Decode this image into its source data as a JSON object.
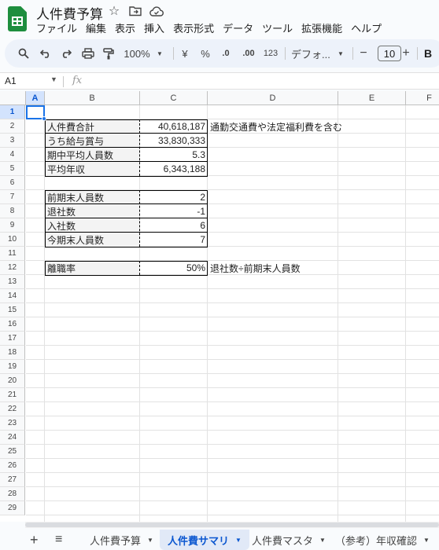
{
  "app": {
    "doc_title": "人件費予算",
    "menu": [
      "ファイル",
      "編集",
      "表示",
      "挿入",
      "表示形式",
      "データ",
      "ツール",
      "拡張機能",
      "ヘルプ"
    ]
  },
  "toolbar": {
    "zoom": "100%",
    "currency": "¥",
    "percent": "%",
    "dec_decrease": ".0",
    "dec_increase": ".00",
    "number_format": "123",
    "font": "デフォ...",
    "font_size": "10",
    "minus": "−",
    "plus": "+",
    "bold": "B"
  },
  "formula_bar": {
    "cell_ref": "A1",
    "fx": "fx",
    "value": ""
  },
  "columns": [
    "A",
    "B",
    "C",
    "D",
    "E",
    "F"
  ],
  "rows": [
    "1",
    "2",
    "3",
    "4",
    "5",
    "6",
    "7",
    "8",
    "9",
    "10",
    "11",
    "12",
    "13",
    "14",
    "15",
    "16",
    "17",
    "18",
    "19",
    "20",
    "21",
    "22",
    "23",
    "24",
    "25",
    "26",
    "27",
    "28",
    "29"
  ],
  "table1": [
    {
      "label": "人件費合計",
      "value": "40,618,187",
      "note": "通勤交通費や法定福利費を含む"
    },
    {
      "label": "うち給与賞与",
      "value": "33,830,333",
      "note": ""
    },
    {
      "label": "期中平均人員数",
      "value": "5.3",
      "note": ""
    },
    {
      "label": "平均年収",
      "value": "6,343,188",
      "note": ""
    }
  ],
  "table2": [
    {
      "label": "前期末人員数",
      "value": "2"
    },
    {
      "label": "退社数",
      "value": "-1"
    },
    {
      "label": "入社数",
      "value": "6"
    },
    {
      "label": "今期末人員数",
      "value": "7"
    }
  ],
  "table3": [
    {
      "label": "離職率",
      "value": "50%",
      "note": "退社数÷前期末人員数"
    }
  ],
  "sheet_tabs": {
    "add": "+",
    "list": "≡",
    "items": [
      "人件費予算",
      "人件費サマリ",
      "人件費マスタ",
      "（参考）年収確認"
    ],
    "active_index": 1
  },
  "colors": {
    "accent": "#0b57d0",
    "logo": "#1e8e3e",
    "selection": "#1a73e8"
  }
}
